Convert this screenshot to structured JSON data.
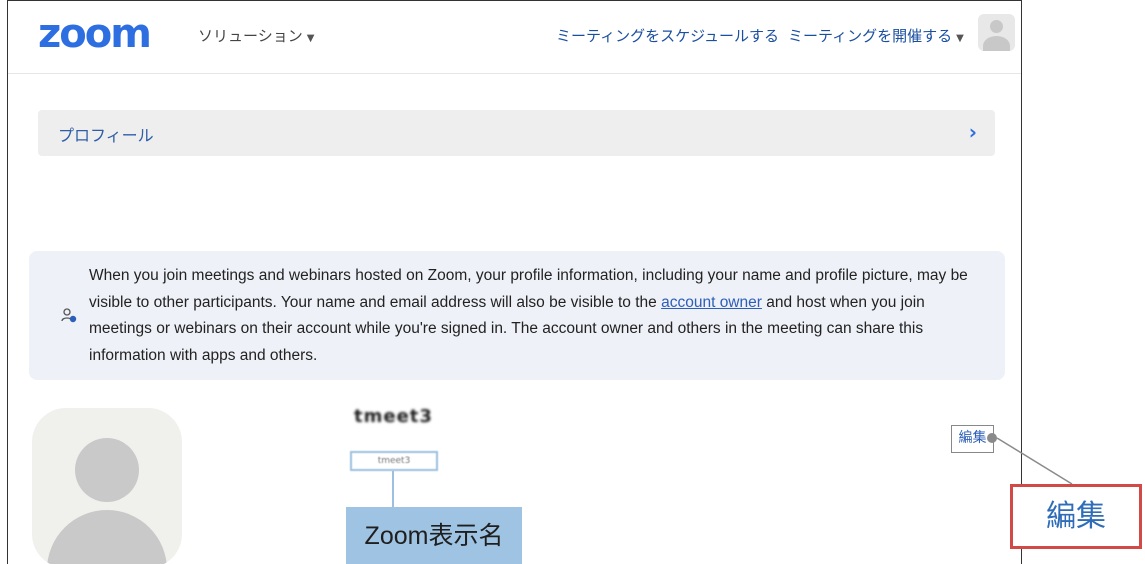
{
  "topbar": {
    "logo": "zoom",
    "solutions_label": "ソリューション",
    "schedule_label": "ミーティングをスケジュールする",
    "host_label": "ミーティングを開催する"
  },
  "profile_bar": {
    "label": "プロフィール",
    "chevron": "›"
  },
  "notice": {
    "text_before": "When you join meetings and webinars hosted on Zoom, your profile information, including your name and profile picture, may be visible to other participants. Your name and email address will also be visible to the ",
    "link_text": "account owner",
    "text_after": " and host when you join meetings or webinars on their account while you're signed in. The account owner and others in the meeting can share this information with apps and others."
  },
  "profile": {
    "display_name": "tmeet3",
    "small_name": "tmeet3",
    "edit_label": "編集"
  },
  "annotations": {
    "display_name_callout": "Zoom表示名",
    "edit_callout": "編集"
  },
  "colors": {
    "brand": "#2d6ee0",
    "callout_blue": "#9fc3e3",
    "callout_red": "#d24a48"
  }
}
